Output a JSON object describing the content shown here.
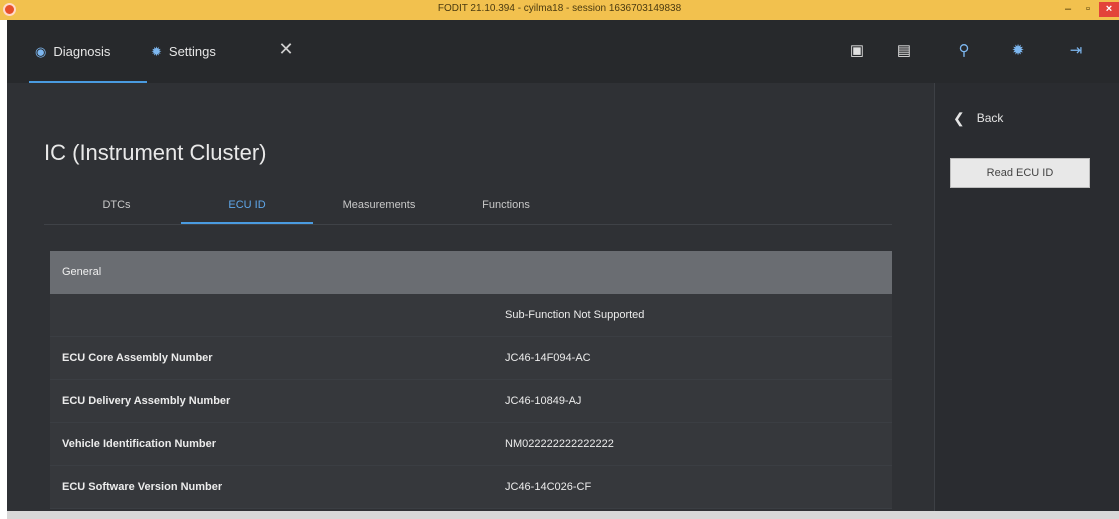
{
  "window": {
    "title": "FODIT 21.10.394 - cyilma18 - session 1636703149838",
    "min_glyph": "–",
    "max_glyph": "▫",
    "close_glyph": "×"
  },
  "nav": {
    "tabs": [
      {
        "label": "Diagnosis",
        "icon": "globe-icon"
      },
      {
        "label": "Settings",
        "icon": "gear-icon"
      }
    ],
    "close_glyph": "✕",
    "toolbar": [
      {
        "icon": "phone-icon",
        "glyph": "▣"
      },
      {
        "icon": "document-icon",
        "glyph": "▤"
      },
      {
        "icon": "search-icon",
        "glyph": "⚲"
      },
      {
        "icon": "settings-icon",
        "glyph": "✹"
      },
      {
        "icon": "logout-icon",
        "glyph": "⇥"
      }
    ]
  },
  "page": {
    "title": "IC (Instrument Cluster)",
    "tabs": [
      "DTCs",
      "ECU ID",
      "Measurements",
      "Functions"
    ],
    "active_tab": "ECU ID"
  },
  "table": {
    "section": "General",
    "rows": [
      {
        "key": "",
        "value": "Sub-Function Not Supported"
      },
      {
        "key": "ECU Core Assembly Number",
        "value": "JC46-14F094-AC"
      },
      {
        "key": "ECU Delivery Assembly Number",
        "value": "JC46-10849-AJ"
      },
      {
        "key": "Vehicle Identification Number",
        "value": "NM022222222222222"
      },
      {
        "key": "ECU Software Version Number",
        "value": "JC46-14C026-CF"
      }
    ]
  },
  "sidepanel": {
    "back_label": "Back",
    "read_button": "Read ECU ID"
  },
  "colors": {
    "accent": "#4a9be0",
    "titlebar": "#f2c14e",
    "background": "#2f3135"
  }
}
